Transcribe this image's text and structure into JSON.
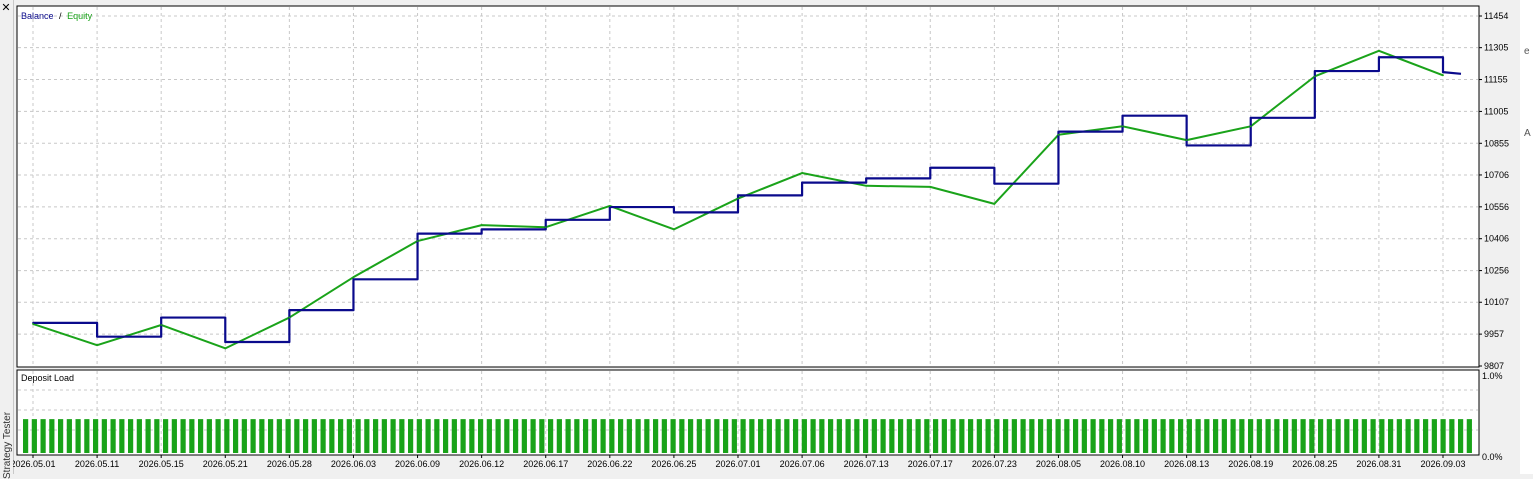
{
  "window": {
    "vertical_title": "Strategy Tester",
    "right_edge_glyphs": [
      "e",
      "A"
    ]
  },
  "main_chart": {
    "legend": [
      {
        "name": "Balance",
        "color": "#0a0a8c"
      },
      {
        "name": "Equity",
        "color": "#1aa31a"
      }
    ],
    "legend_separator": "/",
    "y_tick_labels": [
      "11454",
      "11305",
      "11155",
      "11005",
      "10855",
      "10706",
      "10556",
      "10406",
      "10256",
      "10107",
      "9957",
      "9807"
    ]
  },
  "deposit_load": {
    "title": "Deposit Load",
    "y_tick_labels": [
      "1.0%",
      "0.0%"
    ],
    "bar_color": "#19a319",
    "bar_value_fraction": 0.44
  },
  "x_axis": {
    "tick_labels": [
      "2026.05.01",
      "2026.05.11",
      "2026.05.15",
      "2026.05.21",
      "2026.05.28",
      "2026.06.03",
      "2026.06.09",
      "2026.06.12",
      "2026.06.17",
      "2026.06.22",
      "2026.06.25",
      "2026.07.01",
      "2026.07.06",
      "2026.07.13",
      "2026.07.17",
      "2026.07.23",
      "2026.08.05",
      "2026.08.10",
      "2026.08.13",
      "2026.08.19",
      "2026.08.25",
      "2026.08.31",
      "2026.09.03"
    ]
  },
  "chart_data": {
    "type": "line",
    "title": "",
    "xlabel": "",
    "ylabel": "",
    "ylim": [
      9807,
      11454
    ],
    "grid": true,
    "legend_position": "top-left",
    "x": [
      "2026.05.01",
      "2026.05.11",
      "2026.05.15",
      "2026.05.21",
      "2026.05.28",
      "2026.06.03",
      "2026.06.09",
      "2026.06.12",
      "2026.06.17",
      "2026.06.22",
      "2026.06.25",
      "2026.07.01",
      "2026.07.06",
      "2026.07.13",
      "2026.07.17",
      "2026.07.23",
      "2026.08.05",
      "2026.08.10",
      "2026.08.13",
      "2026.08.19",
      "2026.08.25",
      "2026.08.31",
      "2026.09.03"
    ],
    "series": [
      {
        "name": "Balance",
        "values": [
          10010,
          9945,
          10035,
          9920,
          10070,
          10215,
          10430,
          10450,
          10495,
          10555,
          10530,
          10610,
          10670,
          10690,
          10740,
          10665,
          10910,
          10985,
          10845,
          10975,
          11195,
          11260,
          11190
        ]
      },
      {
        "name": "Equity",
        "values": [
          10005,
          9905,
          10000,
          9890,
          10035,
          10225,
          10395,
          10470,
          10460,
          10560,
          10450,
          10595,
          10715,
          10655,
          10650,
          10570,
          10895,
          10935,
          10870,
          10935,
          11170,
          11290,
          11175
        ]
      }
    ]
  }
}
